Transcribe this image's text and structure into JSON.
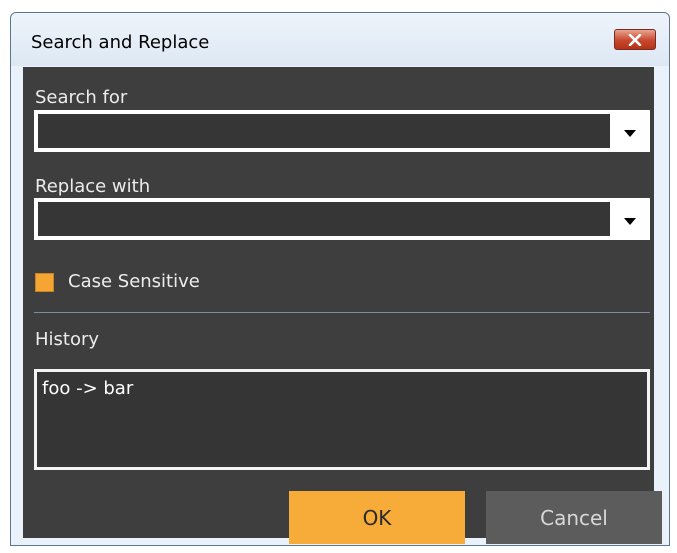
{
  "window": {
    "title": "Search and Replace",
    "close_icon": "close-x-icon"
  },
  "search": {
    "label": "Search for",
    "value": "",
    "dropdown_icon": "chevron-down-icon"
  },
  "replace": {
    "label": "Replace with",
    "value": "",
    "dropdown_icon": "chevron-down-icon"
  },
  "case_sensitive": {
    "label": "Case Sensitive",
    "checked": true,
    "color": "#f4a533"
  },
  "history": {
    "label": "History",
    "items": [
      "foo -> bar"
    ]
  },
  "buttons": {
    "ok_label": "OK",
    "cancel_label": "Cancel"
  },
  "colors": {
    "accent": "#f7ac3a",
    "client_background": "#3e3e3e",
    "close_button": "#c8462e"
  }
}
